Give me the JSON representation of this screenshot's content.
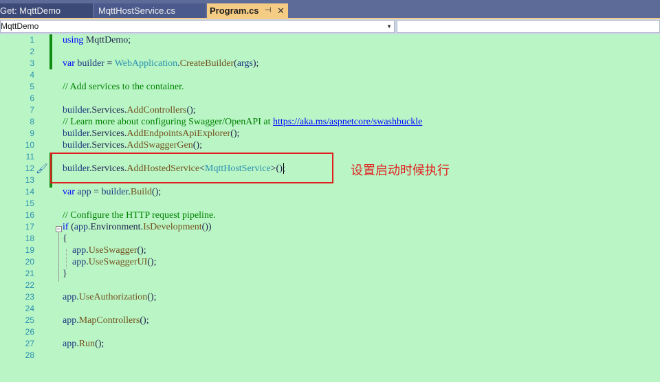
{
  "tabs": [
    {
      "label": "Get: MqttDemo"
    },
    {
      "label": "MqttHostService.cs"
    },
    {
      "label": "Program.cs",
      "active": true
    }
  ],
  "tab_active_icons": {
    "pin": "pin-icon",
    "close": "close-icon"
  },
  "navbar": {
    "project": "MqttDemo",
    "member": ""
  },
  "editor": {
    "line_numbers": [
      "1",
      "2",
      "3",
      "4",
      "5",
      "6",
      "7",
      "8",
      "9",
      "10",
      "11",
      "12",
      "13",
      "14",
      "15",
      "16",
      "17",
      "18",
      "19",
      "20",
      "21",
      "22",
      "23",
      "24",
      "25",
      "26",
      "27",
      "28"
    ],
    "comment_link": "https://aka.ms/aspnetcore/swashbuckle"
  },
  "annotation": "设置启动时候执行",
  "colors": {
    "editor_bg": "#b9f5c5",
    "keyword": "#0000ff",
    "type": "#2b91af",
    "method": "#74531f",
    "comment": "#008000",
    "highlight_box": "#e02020",
    "active_tab": "#f5cc84"
  }
}
